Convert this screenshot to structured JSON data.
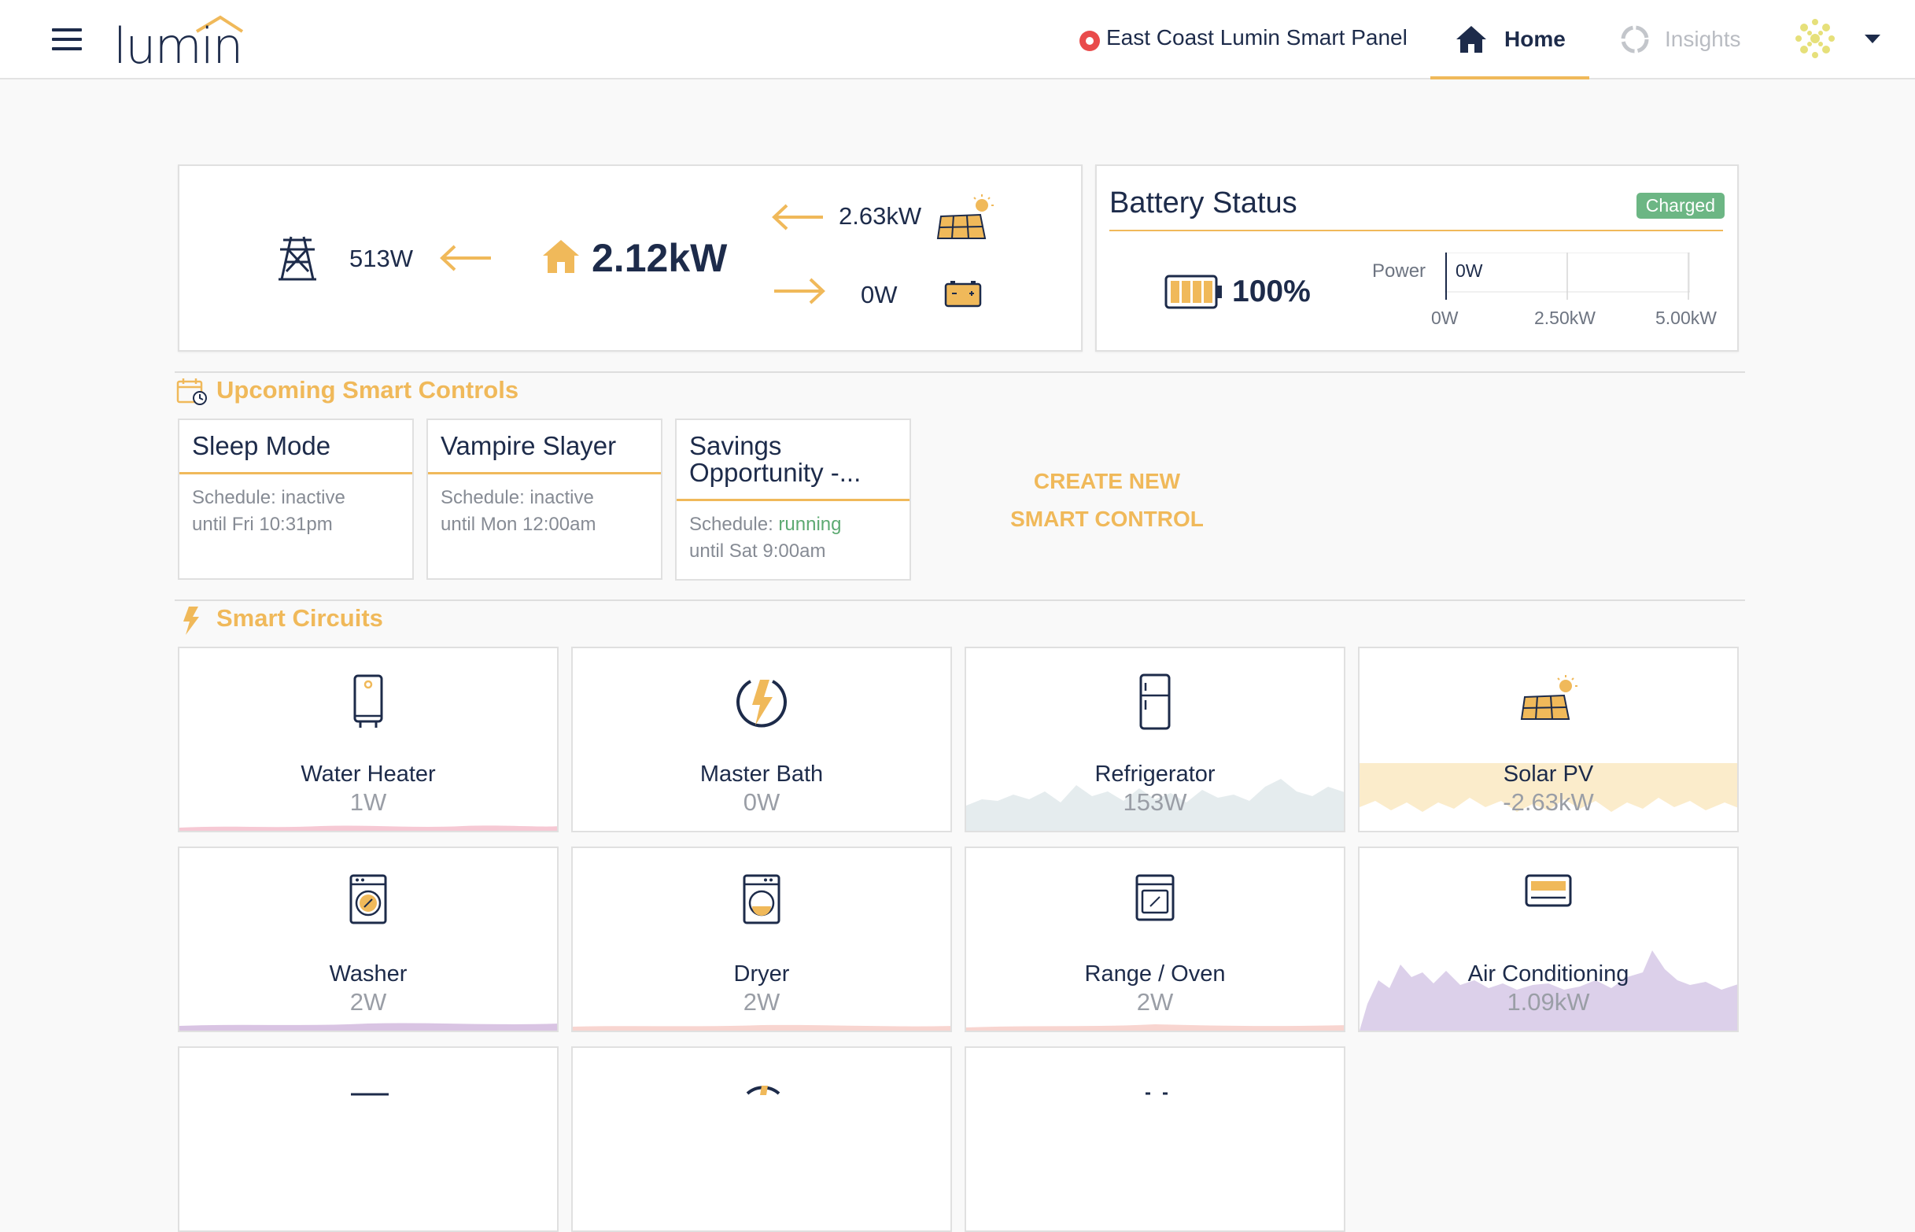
{
  "header": {
    "logo": "lumin",
    "panel_name": "East Coast Lumin Smart Panel",
    "nav_home": "Home",
    "nav_insights": "Insights"
  },
  "flow": {
    "grid_value": "513W",
    "home_value": "2.12kW",
    "solar_value": "2.63kW",
    "battery_value": "0W"
  },
  "battery": {
    "title": "Battery Status",
    "badge": "Charged",
    "percent": "100%",
    "power_label": "Power",
    "power_value": "0W",
    "axis": [
      "0W",
      "2.50kW",
      "5.00kW"
    ],
    "power_fraction": 0
  },
  "smart_controls": {
    "title": "Upcoming Smart Controls",
    "cards": [
      {
        "title": "Sleep Mode",
        "schedule_label": "Schedule:",
        "schedule_status": "inactive",
        "until": "until Fri 10:31pm"
      },
      {
        "title": "Vampire Slayer",
        "schedule_label": "Schedule:",
        "schedule_status": "inactive",
        "until": "until Mon 12:00am"
      },
      {
        "title": "Savings Opportunity -...",
        "schedule_label": "Schedule:",
        "schedule_status": "running",
        "until": "until Sat 9:00am"
      }
    ],
    "create_label": "CREATE NEW SMART CONTROL"
  },
  "smart_circuits": {
    "title": "Smart Circuits",
    "items": [
      {
        "name": "Water Heater",
        "value": "1W",
        "icon": "water-heater-icon"
      },
      {
        "name": "Master Bath",
        "value": "0W",
        "icon": "lightning-circle-icon"
      },
      {
        "name": "Refrigerator",
        "value": "153W",
        "icon": "refrigerator-icon"
      },
      {
        "name": "Solar PV",
        "value": "-2.63kW",
        "icon": "solar-panel-icon"
      },
      {
        "name": "Washer",
        "value": "2W",
        "icon": "washer-icon"
      },
      {
        "name": "Dryer",
        "value": "2W",
        "icon": "dryer-icon"
      },
      {
        "name": "Range / Oven",
        "value": "2W",
        "icon": "oven-icon"
      },
      {
        "name": "Air Conditioning",
        "value": "1.09kW",
        "icon": "air-conditioner-icon"
      }
    ]
  },
  "colors": {
    "accent": "#f0b95a",
    "navy": "#1d2b4a",
    "charged": "#6cb684",
    "alert": "#e94b4b"
  }
}
